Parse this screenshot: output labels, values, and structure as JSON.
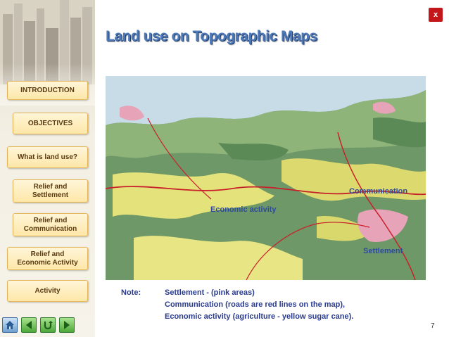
{
  "close_label": "x",
  "title": "Land use on Topographic Maps",
  "sidebar": {
    "items": [
      {
        "label": "INTRODUCTION"
      },
      {
        "label": "OBJECTIVES"
      },
      {
        "label": "What is land use?"
      },
      {
        "label": "Relief and\nSettlement"
      },
      {
        "label": "Relief and\nCommunication"
      },
      {
        "label": "Relief and\nEconomic Activity"
      },
      {
        "label": "Activity"
      }
    ]
  },
  "map": {
    "labels": {
      "communication": "Communication",
      "economic": "Economic activity",
      "settlement": "Settlement"
    }
  },
  "note": {
    "label": "Note:",
    "lines": [
      "Settlement - (pink areas)",
      "Communication (roads are red lines on the map),",
      "Economic activity (agriculture - yellow sugar cane)."
    ]
  },
  "page_number": "7",
  "bottom_nav": {
    "icons": [
      "home-icon",
      "back-arrow-icon",
      "return-icon",
      "forward-arrow-icon"
    ]
  },
  "colors": {
    "title": "#4e79b8",
    "nav_button": "#fde7a8",
    "close": "#c4171b",
    "map_label": "#2e4a9e"
  }
}
